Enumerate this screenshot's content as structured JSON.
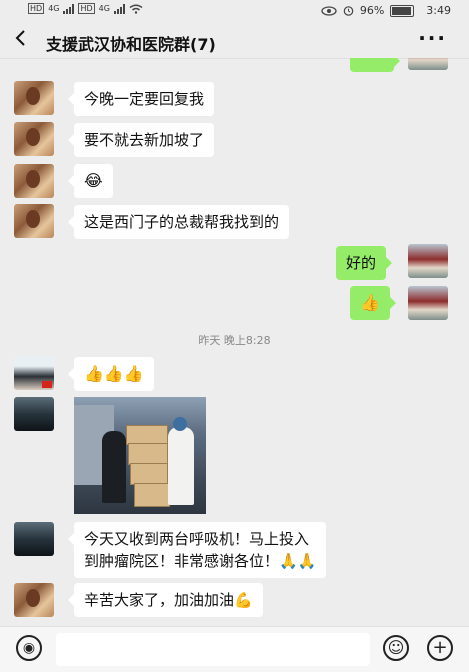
{
  "status_bar": {
    "left_hd_1": "HD",
    "left_4g_1": "4G",
    "left_hd_2": "HD",
    "left_4g_2": "4G",
    "battery": "96%",
    "battery_level": 0.96,
    "time": "3:49"
  },
  "title_bar": {
    "back_icon": "chevron-left-icon",
    "title": "支援武汉协和医院群(7)",
    "more_label": "···"
  },
  "messages": [
    {
      "side": "left",
      "avatar": "woman-avatar",
      "text": "今晚一定要回复我"
    },
    {
      "side": "left",
      "avatar": "woman-avatar",
      "text": "要不就去新加坡了"
    },
    {
      "side": "left",
      "avatar": "woman-avatar",
      "text": "😂"
    },
    {
      "side": "left",
      "avatar": "woman-avatar",
      "text": "这是西门子的总裁帮我找到的"
    },
    {
      "side": "right",
      "avatar": "my-avatar",
      "text": "好的"
    },
    {
      "side": "right",
      "avatar": "my-avatar",
      "text": "👍"
    },
    {
      "side": "left",
      "avatar": "portrait-avatar",
      "text": "👍👍👍"
    },
    {
      "side": "left",
      "avatar": "dark-avatar",
      "image": "photo-two-people-with-boxes"
    },
    {
      "side": "left",
      "avatar": "dark-avatar",
      "text_line1": "今天又收到两台呼吸机！马上投入",
      "text_line2": "到肿瘤院区！非常感谢各位！🙏🙏"
    },
    {
      "side": "left",
      "avatar": "woman-avatar",
      "text": "辛苦大家了，加油加油💪"
    }
  ],
  "timestamp": "昨天 晚上8:28",
  "bottom_bar": {
    "voice_icon": "voice-icon",
    "input_value": "",
    "emoji_icon": "smile-icon",
    "plus_icon": "plus-icon",
    "voice_glyph": "◉",
    "emoji_glyph": "☺",
    "plus_glyph": "+"
  },
  "colors": {
    "background": "#ededed",
    "my_bubble": "#95ec69",
    "other_bubble": "#ffffff"
  }
}
